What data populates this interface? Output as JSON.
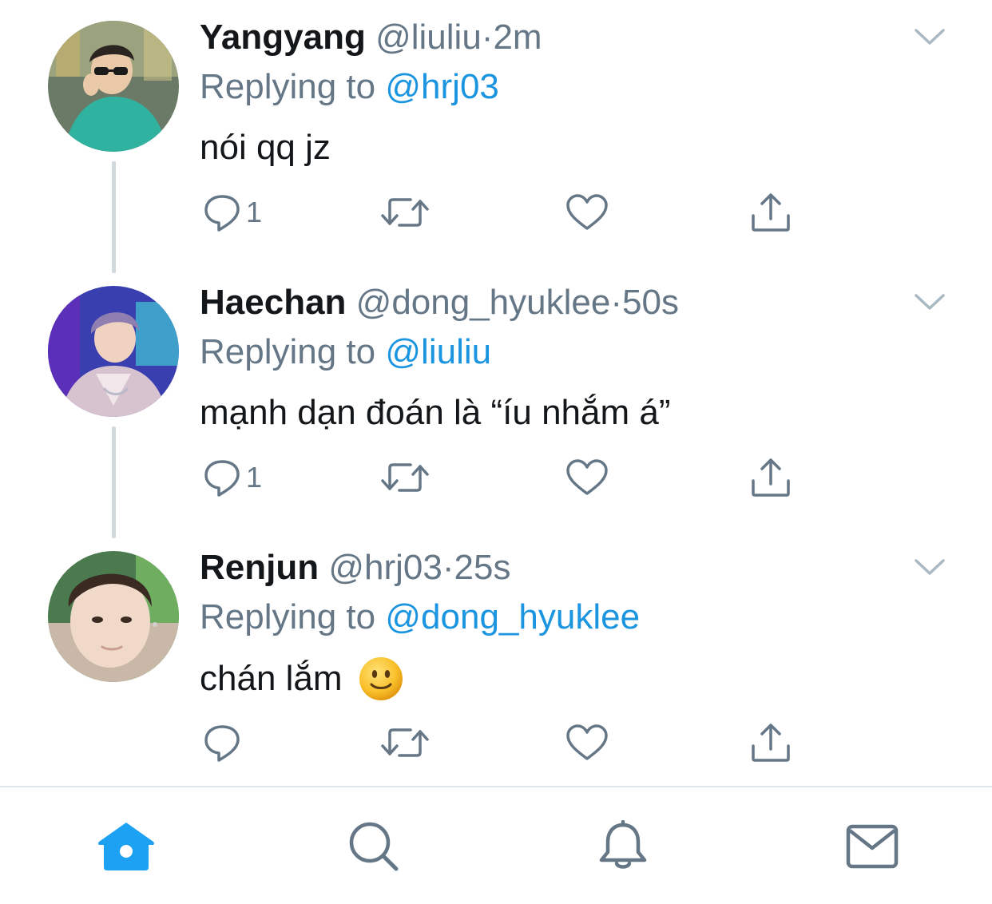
{
  "tweets": [
    {
      "name": "Yangyang",
      "handle": "@liuliu",
      "dot": "·",
      "time": "2m",
      "replying_label": "Replying to",
      "replying_to": "@hrj03",
      "text": "nói qq jz",
      "reply_count": "1",
      "avatar_icon": "avatar-photo",
      "colors": {
        "bg": "#5a6b5e",
        "accent": "#2fb3a0"
      }
    },
    {
      "name": "Haechan",
      "handle": "@dong_hyuklee",
      "dot": "·",
      "time": "50s",
      "replying_label": "Replying to",
      "replying_to": "@liuliu",
      "text": "mạnh dạn đoán là “íu nhắm á”",
      "reply_count": "1",
      "avatar_icon": "avatar-photo",
      "colors": {
        "bg": "#3a3fb0",
        "accent": "#d7c3cf"
      }
    },
    {
      "name": "Renjun",
      "handle": "@hrj03",
      "dot": "·",
      "time": "25s",
      "replying_label": "Replying to",
      "replying_to": "@dong_hyuklee",
      "text": "chán lắm",
      "reply_count": "",
      "avatar_icon": "avatar-photo",
      "emoji": "slightly-smiling-face",
      "colors": {
        "bg": "#4b7a4f",
        "accent": "#f0d9c8"
      }
    }
  ],
  "tabbar": {
    "items": [
      "home-icon",
      "search-icon",
      "notifications-icon",
      "messages-icon"
    ],
    "active": "home-icon"
  },
  "colors": {
    "link": "#1b95e0",
    "muted": "#657786",
    "text": "#14171a",
    "icon": "#657786",
    "active_tab": "#1da1f2",
    "thread_line": "#cfd9de"
  }
}
